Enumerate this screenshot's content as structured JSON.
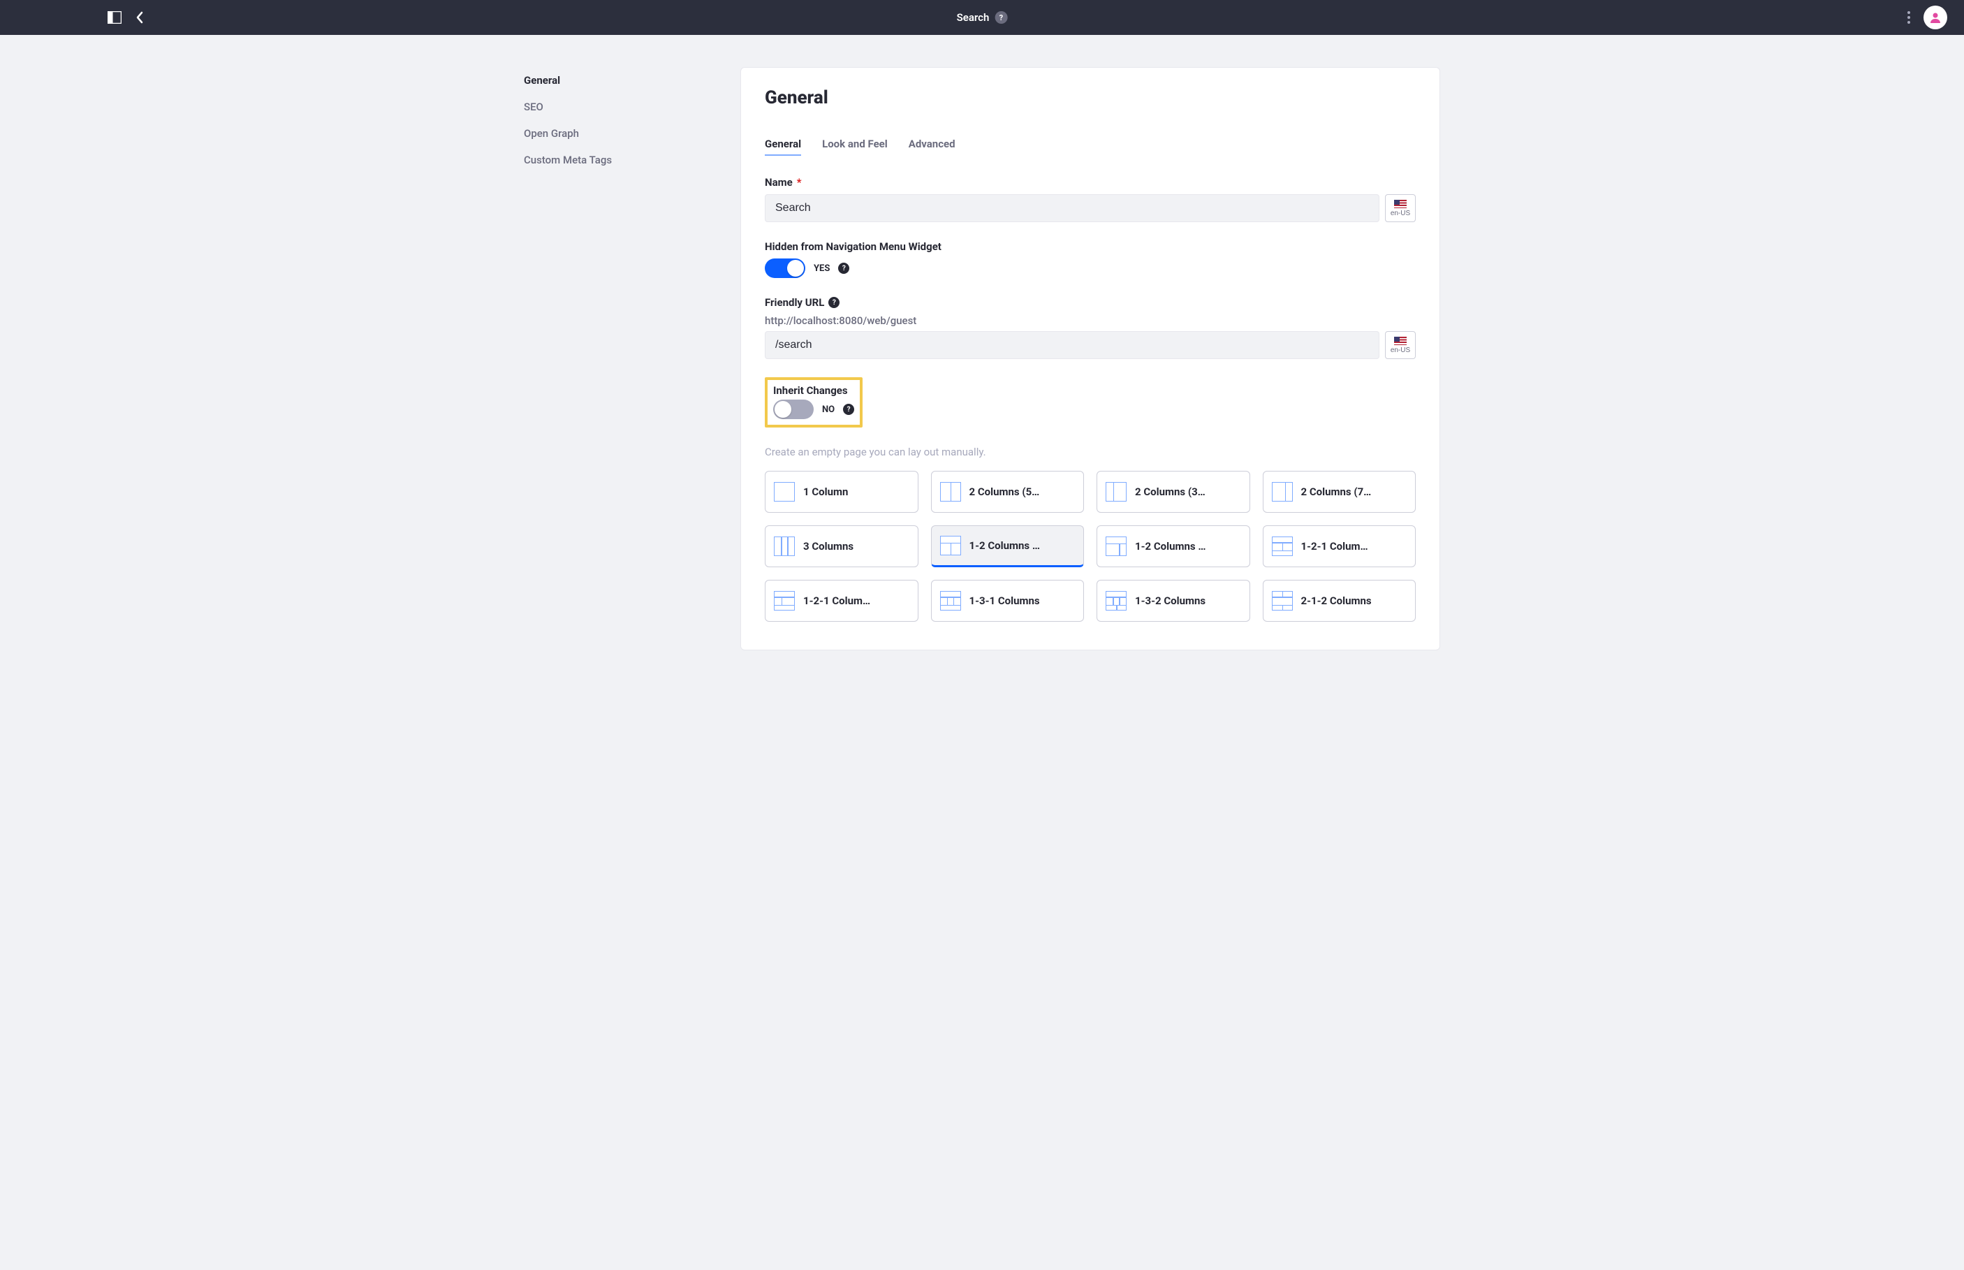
{
  "header": {
    "title": "Search"
  },
  "sidebar": {
    "items": [
      {
        "label": "General",
        "active": true
      },
      {
        "label": "SEO",
        "active": false
      },
      {
        "label": "Open Graph",
        "active": false
      },
      {
        "label": "Custom Meta Tags",
        "active": false
      }
    ]
  },
  "page": {
    "title": "General",
    "tabs": [
      {
        "label": "General",
        "active": true
      },
      {
        "label": "Look and Feel",
        "active": false
      },
      {
        "label": "Advanced",
        "active": false
      }
    ]
  },
  "form": {
    "name_label": "Name",
    "name_value": "Search",
    "hidden_label": "Hidden from Navigation Menu Widget",
    "hidden_on": true,
    "hidden_state_text": "YES",
    "friendly_url_label": "Friendly URL",
    "friendly_url_prefix": "http://localhost:8080/web/guest",
    "friendly_url_value": "/search",
    "inherit_label": "Inherit Changes",
    "inherit_on": false,
    "inherit_state_text": "NO",
    "locale": "en-US",
    "layout_hint": "Create an empty page you can lay out manually.",
    "layouts": [
      {
        "label": "1 Column",
        "thumb": "t-1col",
        "selected": false
      },
      {
        "label": "2 Columns (5…",
        "thumb": "t-2col t-2col-50",
        "selected": false
      },
      {
        "label": "2 Columns (3…",
        "thumb": "t-2col t-2col-30",
        "selected": false
      },
      {
        "label": "2 Columns (7…",
        "thumb": "t-2col t-2col-70",
        "selected": false
      },
      {
        "label": "3 Columns",
        "thumb": "t-3col",
        "selected": false
      },
      {
        "label": "1-2 Columns …",
        "thumb": "t-1-2a",
        "selected": true
      },
      {
        "label": "1-2 Columns …",
        "thumb": "t-1-2b",
        "selected": false
      },
      {
        "label": "1-2-1 Colum…",
        "thumb": "t-1-2-1",
        "selected": false
      },
      {
        "label": "1-2-1 Colum…",
        "thumb": "t-1-2-1b",
        "selected": false
      },
      {
        "label": "1-3-1 Columns",
        "thumb": "t-1-3-1",
        "selected": false
      },
      {
        "label": "1-3-2 Columns",
        "thumb": "t-1-3-2",
        "selected": false
      },
      {
        "label": "2-1-2 Columns",
        "thumb": "t-2-1-2",
        "selected": false
      }
    ]
  }
}
